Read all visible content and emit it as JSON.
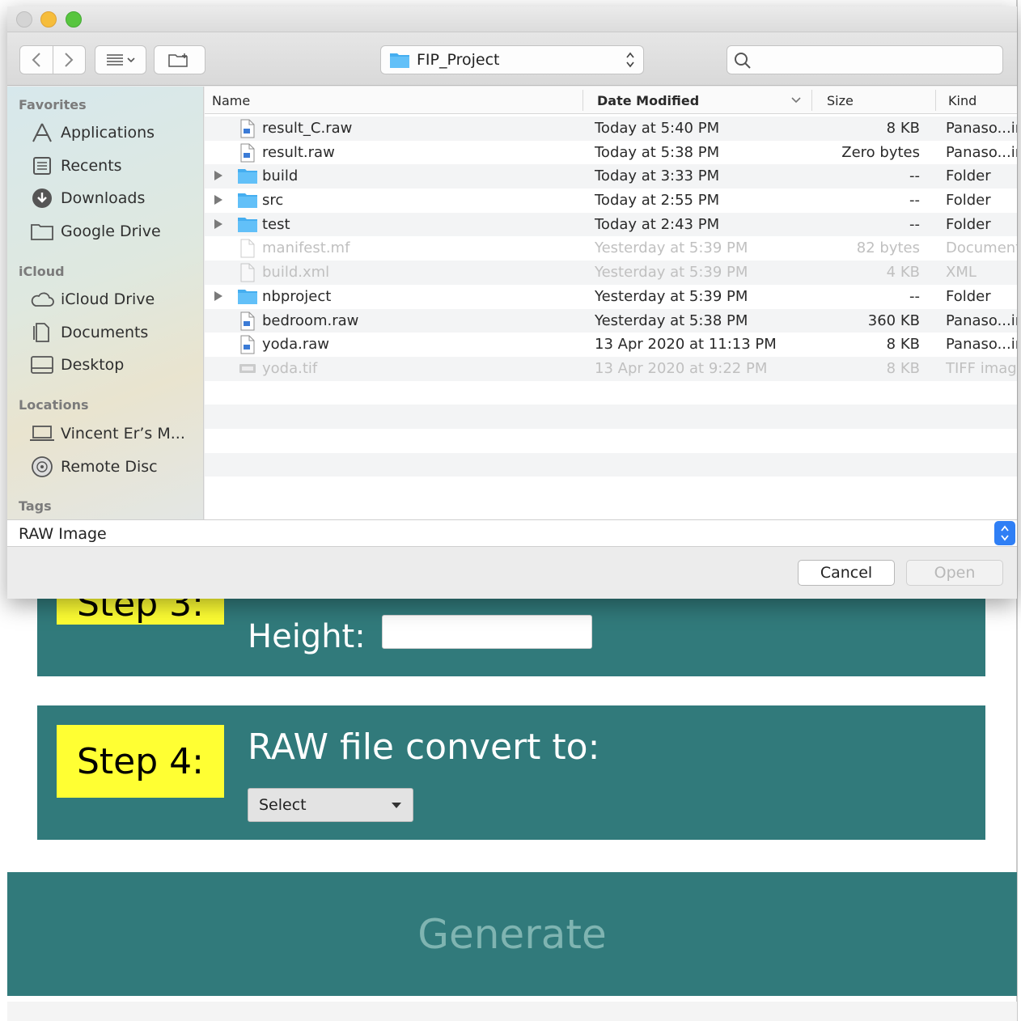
{
  "dialog": {
    "path_popup": {
      "folder": "FIP_Project"
    },
    "search": {
      "placeholder": ""
    },
    "sidebar": {
      "sections": [
        {
          "heading": "Favorites",
          "items": [
            "Applications",
            "Recents",
            "Downloads",
            "Google Drive"
          ]
        },
        {
          "heading": "iCloud",
          "items": [
            "iCloud Drive",
            "Documents",
            "Desktop"
          ]
        },
        {
          "heading": "Locations",
          "items": [
            "Vincent Er’s M...",
            "Remote Disc"
          ]
        },
        {
          "heading": "Tags",
          "items": []
        }
      ]
    },
    "columns": {
      "name": "Name",
      "date": "Date Modified",
      "size": "Size",
      "kind": "Kind"
    },
    "files": [
      {
        "name": "result_C.raw",
        "date": "Today at 5:40 PM",
        "size": "8 KB",
        "kind": "Panaso...image",
        "type": "raw",
        "expandable": false,
        "dimmed": false
      },
      {
        "name": "result.raw",
        "date": "Today at 5:38 PM",
        "size": "Zero bytes",
        "kind": "Panaso...image",
        "type": "raw",
        "expandable": false,
        "dimmed": false
      },
      {
        "name": "build",
        "date": "Today at 3:33 PM",
        "size": "--",
        "kind": "Folder",
        "type": "folder",
        "expandable": true,
        "dimmed": false
      },
      {
        "name": "src",
        "date": "Today at 2:55 PM",
        "size": "--",
        "kind": "Folder",
        "type": "folder",
        "expandable": true,
        "dimmed": false
      },
      {
        "name": "test",
        "date": "Today at 2:43 PM",
        "size": "--",
        "kind": "Folder",
        "type": "folder",
        "expandable": true,
        "dimmed": false
      },
      {
        "name": "manifest.mf",
        "date": "Yesterday at 5:39 PM",
        "size": "82 bytes",
        "kind": "Document",
        "type": "doc",
        "expandable": false,
        "dimmed": true
      },
      {
        "name": "build.xml",
        "date": "Yesterday at 5:39 PM",
        "size": "4 KB",
        "kind": "XML",
        "type": "doc",
        "expandable": false,
        "dimmed": true
      },
      {
        "name": "nbproject",
        "date": "Yesterday at 5:39 PM",
        "size": "--",
        "kind": "Folder",
        "type": "folder",
        "expandable": true,
        "dimmed": false
      },
      {
        "name": "bedroom.raw",
        "date": "Yesterday at 5:38 PM",
        "size": "360 KB",
        "kind": "Panaso...image",
        "type": "raw",
        "expandable": false,
        "dimmed": false
      },
      {
        "name": "yoda.raw",
        "date": "13 Apr 2020 at 11:13 PM",
        "size": "8 KB",
        "kind": "Panaso...image",
        "type": "raw",
        "expandable": false,
        "dimmed": false
      },
      {
        "name": "yoda.tif",
        "date": "13 Apr 2020 at 9:22 PM",
        "size": "8 KB",
        "kind": "TIFF image",
        "type": "tif",
        "expandable": false,
        "dimmed": true
      }
    ],
    "filter": {
      "value": "RAW Image"
    },
    "buttons": {
      "cancel": "Cancel",
      "open": "Open"
    }
  },
  "page": {
    "step3": {
      "label": "Step 3:",
      "height_label": "Height:"
    },
    "step4": {
      "label": "Step 4:",
      "convert_label": "RAW file convert to:",
      "select_value": "Select"
    },
    "generate": "Generate"
  }
}
